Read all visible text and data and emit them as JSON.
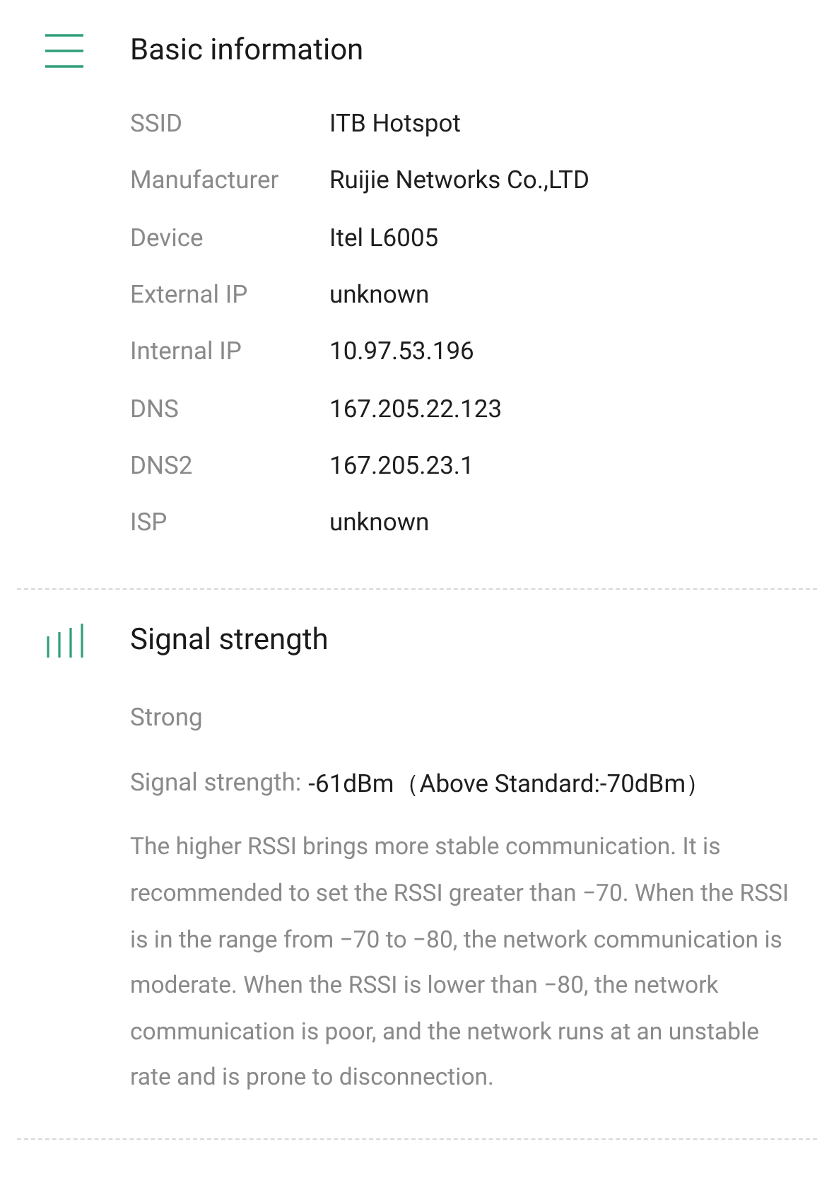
{
  "sections": [
    {
      "kind": "info",
      "title": "Basic information",
      "rows": [
        {
          "label": "SSID",
          "value": "ITB Hotspot"
        },
        {
          "label": "Manufacturer",
          "value": "Ruijie Networks Co.,LTD"
        },
        {
          "label": "Device",
          "value": "Itel L6005"
        },
        {
          "label": "External IP",
          "value": "unknown"
        },
        {
          "label": "Internal IP",
          "value": "10.97.53.196"
        },
        {
          "label": "DNS",
          "value": "167.205.22.123"
        },
        {
          "label": "DNS2",
          "value": "167.205.23.1"
        },
        {
          "label": "ISP",
          "value": "unknown"
        }
      ]
    },
    {
      "kind": "signal",
      "title": "Signal strength",
      "status": "Strong",
      "reading_label": "Signal strength:",
      "reading_value": "-61dBm（Above Standard:-70dBm）",
      "description": "The higher RSSI brings more stable communication. It is recommended to set the RSSI greater than −70. When the RSSI is in the range from −70 to −80, the network communication is moderate. When the RSSI is lower than −80, the network communication is poor, and the network runs at an unstable rate and is prone to disconnection."
    }
  ]
}
